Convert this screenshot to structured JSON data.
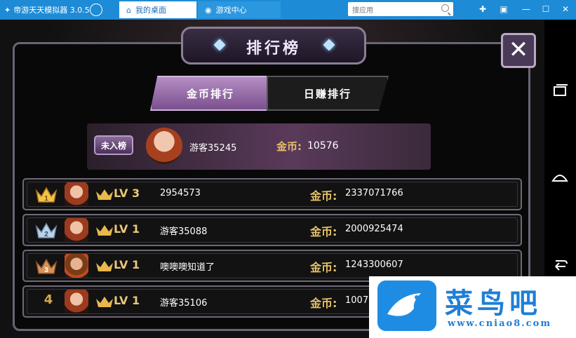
{
  "emulator": {
    "app_title": "帝游天天模拟器 3.0.5",
    "tabs": [
      {
        "label": "我的桌面",
        "active": true
      },
      {
        "label": "游戏中心",
        "active": false
      }
    ],
    "search_placeholder": "搜应用",
    "window_buttons": [
      "pin",
      "restore",
      "minimize",
      "maximize",
      "close"
    ]
  },
  "game": {
    "title": "排行榜",
    "close_label": "✕",
    "tabs": [
      {
        "label": "金币排行",
        "active": true
      },
      {
        "label": "日赚排行",
        "active": false
      }
    ],
    "my_rank": {
      "badge": "未入榜",
      "name": "游客35245",
      "coin_label": "金币:",
      "coin_value": "10576"
    },
    "rows": [
      {
        "rank": "1",
        "crown": "gold",
        "lv": "LV 3",
        "name": "2954573",
        "coin_label": "金币:",
        "coin": "2337071766"
      },
      {
        "rank": "2",
        "crown": "silver",
        "lv": "LV 1",
        "name": "游客35088",
        "coin_label": "金币:",
        "coin": "2000925474"
      },
      {
        "rank": "3",
        "crown": "bronze",
        "lv": "LV 1",
        "name": "噢噢噢知道了",
        "coin_label": "金币:",
        "coin": "1243300607"
      },
      {
        "rank": "4",
        "crown": "none",
        "lv": "LV 1",
        "name": "游客35106",
        "coin_label": "金币:",
        "coin": "1007"
      }
    ]
  },
  "colors": {
    "titlebar": "#1e8bd6",
    "gold_text": "#e6c069",
    "tab_active": "#9a6aae"
  },
  "watermark": {
    "text": "菜鸟吧",
    "url": "www.cniao8.com"
  }
}
